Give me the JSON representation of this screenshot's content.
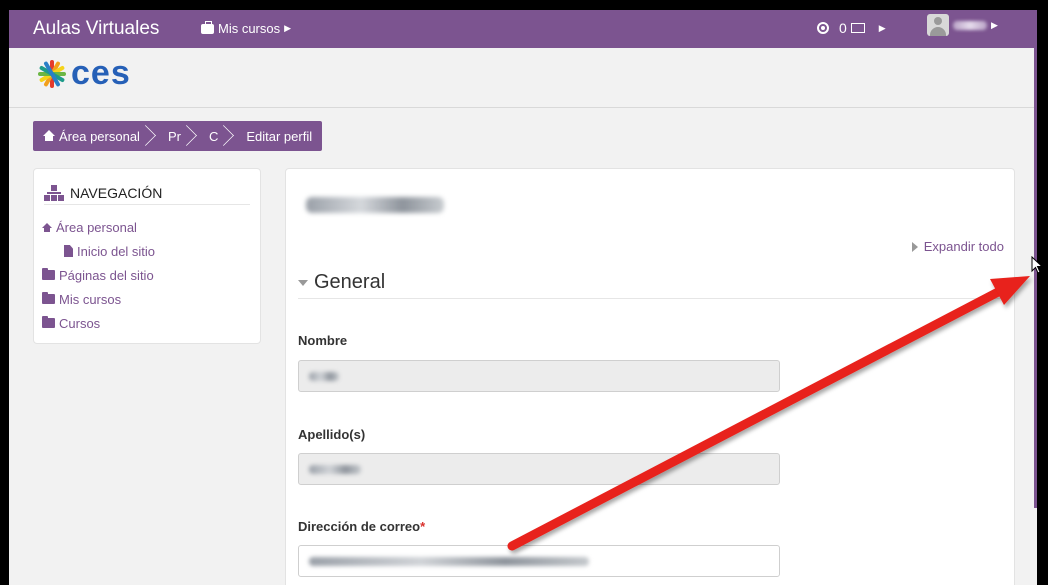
{
  "navbar": {
    "brand": "Aulas Virtuales",
    "my_courses": "Mis cursos",
    "messages_count": "0"
  },
  "logo": {
    "text": "ces"
  },
  "breadcrumb": [
    {
      "label": "Área personal"
    },
    {
      "label": "Pr"
    },
    {
      "label": "C"
    },
    {
      "label": "Editar perfil"
    }
  ],
  "navigation": {
    "title": "NAVEGACIÓN",
    "items": [
      {
        "label": "Área personal",
        "icon": "home-icon"
      },
      {
        "label": "Inicio del sitio",
        "icon": "file-icon"
      },
      {
        "label": "Páginas del sitio",
        "icon": "folder-icon"
      },
      {
        "label": "Mis cursos",
        "icon": "folder-icon"
      },
      {
        "label": "Cursos",
        "icon": "folder-icon"
      }
    ]
  },
  "form": {
    "expand_all": "Expandir todo",
    "section": "General",
    "fields": [
      {
        "label": "Nombre",
        "required": false
      },
      {
        "label": "Apellido(s)",
        "required": false
      },
      {
        "label": "Dirección de correo",
        "required": true,
        "required_mark": "*"
      }
    ]
  },
  "colors": {
    "primary": "#7c5490",
    "annotation_arrow": "#e8201a",
    "logo_blue": "#2660b7"
  }
}
